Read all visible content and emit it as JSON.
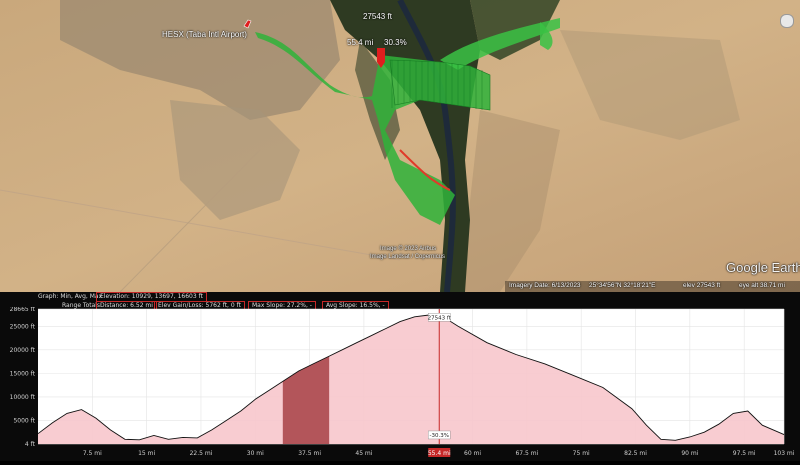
{
  "map": {
    "placemark_label": "HESX (Taba Intl Airport)",
    "cursor_altitude": "27543 ft",
    "cursor_distance": "55.4 mi",
    "cursor_slope": "30.3%",
    "imagery_credit_1": "Image © 2023 Airbus",
    "imagery_credit_2": "Image Landsat / Copernicus",
    "google_logo": "Google Earth",
    "status_imagery_date": "Imagery Date: 6/13/2023",
    "status_coords": "25°34'56\"N 32°18'21\"E",
    "status_elev": "elev 27543 ft",
    "status_eye": "eye alt 38.71 mi"
  },
  "elevation_profile": {
    "graph_label": "Graph: Min, Avg, Max",
    "elevation_stat": "Elevation: 10929, 13697, 16603 ft",
    "range_label": "Range Totals:",
    "distance_stat": "Distance: 6.52 mi",
    "gain_loss_stat": "Elev Gain/Loss: 5762 ft, 0 ft",
    "max_slope_stat": "Max Slope: 27.2%, -",
    "avg_slope_stat": "Avg Slope: 16.5%, -",
    "y_ticks": [
      "28665 ft",
      "25000 ft",
      "20000 ft",
      "15000 ft",
      "10000 ft",
      "5000 ft",
      "4 ft"
    ],
    "x_ticks": [
      "7.5 mi",
      "15 mi",
      "22.5 mi",
      "30 mi",
      "37.5 mi",
      "45 mi",
      "55.4 mi",
      "60 mi",
      "67.5 mi",
      "75 mi",
      "82.5 mi",
      "90 mi",
      "97.5 mi",
      "103 mi"
    ],
    "peak_label": "27543 ft",
    "cursor_slope_label": "-30.3%",
    "colors": {
      "fill": "#f7c6cc",
      "line": "#111111",
      "selection": "#b3555a",
      "cursor": "#c62828",
      "stat_border": "#c62828"
    }
  },
  "chart_data": {
    "type": "area",
    "title": "",
    "xlabel": "",
    "ylabel": "",
    "xlim": [
      0,
      103
    ],
    "ylim": [
      4,
      28665
    ],
    "x": [
      0,
      2,
      4,
      6,
      8,
      10,
      12,
      14,
      16,
      18,
      20,
      22,
      24,
      26,
      28,
      30,
      32,
      34,
      36,
      38,
      40,
      42,
      44,
      46,
      48,
      50,
      52,
      54,
      55.4,
      58,
      62,
      66,
      70,
      74,
      78,
      82,
      84,
      86,
      88,
      90,
      92,
      94,
      96,
      98,
      100,
      103
    ],
    "y": [
      2200,
      4500,
      6500,
      7300,
      5500,
      3000,
      1000,
      900,
      1800,
      1000,
      1400,
      1300,
      3000,
      5000,
      7000,
      9500,
      11500,
      13500,
      15500,
      17000,
      18500,
      20000,
      21500,
      23000,
      24500,
      26000,
      27000,
      27400,
      27543,
      25000,
      21500,
      19000,
      17000,
      14500,
      12000,
      7500,
      4000,
      1000,
      800,
      1500,
      2500,
      4200,
      6500,
      7000,
      4000,
      2000
    ],
    "selection_x": [
      33.8,
      40.2
    ],
    "cursor_x": 55.4,
    "grid": true
  }
}
